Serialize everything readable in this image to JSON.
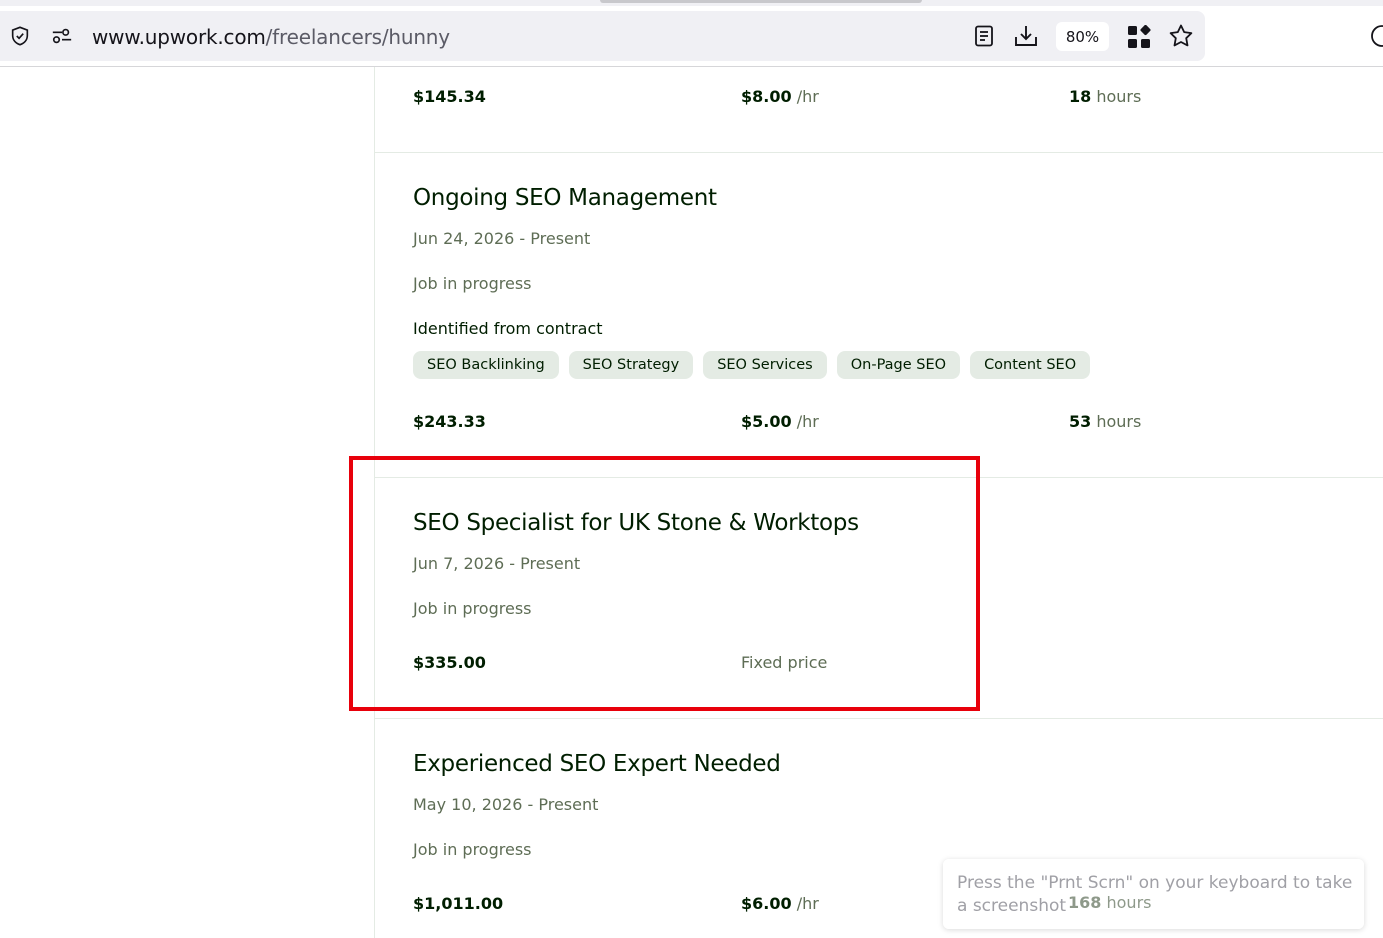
{
  "browser": {
    "url_host": "www.upwork.com",
    "url_path": "/freelancers/hunny",
    "zoom": "80%"
  },
  "jobs": [
    {
      "earned": "$145.34",
      "rate": "$8.00",
      "rate_unit": " /hr",
      "hours_value": "18",
      "hours_unit": " hours"
    },
    {
      "title": "Ongoing SEO Management",
      "dates": "Jun 24, 2026 - Present",
      "status": "Job in progress",
      "skills_label": "Identified from contract",
      "skills": [
        "SEO Backlinking",
        "SEO Strategy",
        "SEO Services",
        "On-Page SEO",
        "Content SEO"
      ],
      "earned": "$243.33",
      "rate": "$5.00",
      "rate_unit": " /hr",
      "hours_value": "53",
      "hours_unit": " hours"
    },
    {
      "title": "SEO Specialist for UK Stone & Worktops",
      "dates": "Jun 7, 2026 - Present",
      "status": "Job in progress",
      "earned": "$335.00",
      "pricing": "Fixed price"
    },
    {
      "title": "Experienced SEO Expert Needed",
      "dates": "May 10, 2026 - Present",
      "status": "Job in progress",
      "earned": "$1,011.00",
      "rate": "$6.00",
      "rate_unit": " /hr",
      "hours_value": "168",
      "hours_unit": " hours"
    }
  ],
  "toast": {
    "message": "Press the \"Prnt Scrn\" on your keyboard to take a screenshot"
  },
  "colors": {
    "highlight": "#e8000b",
    "chip_bg": "#e4ebe4",
    "muted_text": "#5e6d55"
  }
}
